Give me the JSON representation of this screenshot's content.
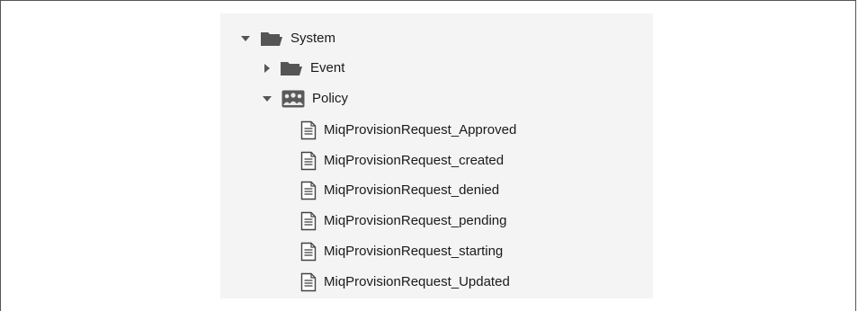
{
  "tree": {
    "root": {
      "label": "System",
      "icon": "folder-open-icon",
      "expanded": true,
      "children": [
        {
          "label": "Event",
          "icon": "folder-open-icon",
          "expanded": false
        },
        {
          "label": "Policy",
          "icon": "policy-group-icon",
          "expanded": true,
          "items": [
            {
              "label": "MiqProvisionRequest_Approved",
              "icon": "document-icon"
            },
            {
              "label": "MiqProvisionRequest_created",
              "icon": "document-icon"
            },
            {
              "label": "MiqProvisionRequest_denied",
              "icon": "document-icon"
            },
            {
              "label": "MiqProvisionRequest_pending",
              "icon": "document-icon"
            },
            {
              "label": "MiqProvisionRequest_starting",
              "icon": "document-icon"
            },
            {
              "label": "MiqProvisionRequest_Updated",
              "icon": "document-icon"
            }
          ]
        }
      ]
    }
  },
  "colors": {
    "panel_background": "#f4f4f4",
    "icon_gray": "#555555",
    "text": "#1a1a1a"
  }
}
